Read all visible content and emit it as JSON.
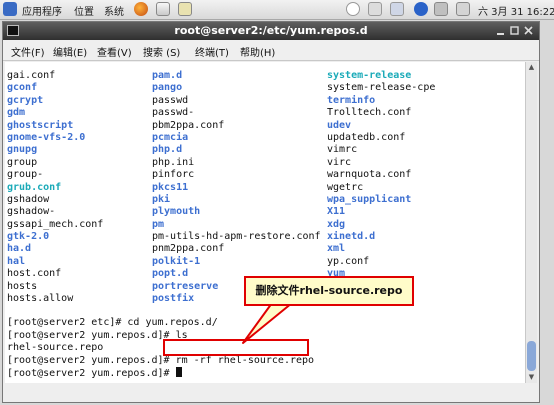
{
  "panel": {
    "menus": [
      "应用程序",
      "位置",
      "系统"
    ],
    "clock": "六 3月 31 16:22"
  },
  "window": {
    "title": "root@server2:/etc/yum.repos.d",
    "menu": [
      "文件(F)",
      "编辑(E)",
      "查看(V)",
      "搜索 (S)",
      "终端(T)",
      "帮助(H)"
    ]
  },
  "listing": {
    "col1": [
      {
        "text": "gai.conf",
        "type": "plain"
      },
      {
        "text": "gconf",
        "type": "dir"
      },
      {
        "text": "gcrypt",
        "type": "dir"
      },
      {
        "text": "gdm",
        "type": "dir"
      },
      {
        "text": "ghostscript",
        "type": "dir"
      },
      {
        "text": "gnome-vfs-2.0",
        "type": "dir"
      },
      {
        "text": "gnupg",
        "type": "dir"
      },
      {
        "text": "group",
        "type": "plain"
      },
      {
        "text": "group-",
        "type": "plain"
      },
      {
        "text": "grub.conf",
        "type": "link"
      },
      {
        "text": "gshadow",
        "type": "plain"
      },
      {
        "text": "gshadow-",
        "type": "plain"
      },
      {
        "text": "gssapi_mech.conf",
        "type": "plain"
      },
      {
        "text": "gtk-2.0",
        "type": "dir"
      },
      {
        "text": "ha.d",
        "type": "dir"
      },
      {
        "text": "hal",
        "type": "dir"
      },
      {
        "text": "host.conf",
        "type": "plain"
      },
      {
        "text": "hosts",
        "type": "plain"
      },
      {
        "text": "hosts.allow",
        "type": "plain"
      }
    ],
    "col2": [
      {
        "text": "pam.d",
        "type": "dir"
      },
      {
        "text": "pango",
        "type": "dir"
      },
      {
        "text": "passwd",
        "type": "plain"
      },
      {
        "text": "passwd-",
        "type": "plain"
      },
      {
        "text": "pbm2ppa.conf",
        "type": "plain"
      },
      {
        "text": "pcmcia",
        "type": "dir"
      },
      {
        "text": "php.d",
        "type": "dir"
      },
      {
        "text": "php.ini",
        "type": "plain"
      },
      {
        "text": "pinforc",
        "type": "plain"
      },
      {
        "text": "pkcs11",
        "type": "dir"
      },
      {
        "text": "pki",
        "type": "dir"
      },
      {
        "text": "plymouth",
        "type": "dir"
      },
      {
        "text": "pm",
        "type": "dir"
      },
      {
        "text": "pm-utils-hd-apm-restore.conf",
        "type": "plain"
      },
      {
        "text": "pnm2ppa.conf",
        "type": "plain"
      },
      {
        "text": "polkit-1",
        "type": "dir"
      },
      {
        "text": "popt.d",
        "type": "dir"
      },
      {
        "text": "portreserve",
        "type": "dir"
      },
      {
        "text": "postfix",
        "type": "dir"
      }
    ],
    "col3": [
      {
        "text": "system-release",
        "type": "link"
      },
      {
        "text": "system-release-cpe",
        "type": "plain"
      },
      {
        "text": "terminfo",
        "type": "dir"
      },
      {
        "text": "Trolltech.conf",
        "type": "plain"
      },
      {
        "text": "udev",
        "type": "dir"
      },
      {
        "text": "updatedb.conf",
        "type": "plain"
      },
      {
        "text": "vimrc",
        "type": "plain"
      },
      {
        "text": "virc",
        "type": "plain"
      },
      {
        "text": "warnquota.conf",
        "type": "plain"
      },
      {
        "text": "wgetrc",
        "type": "plain"
      },
      {
        "text": "wpa_supplicant",
        "type": "dir"
      },
      {
        "text": "X11",
        "type": "dir"
      },
      {
        "text": "xdg",
        "type": "dir"
      },
      {
        "text": "xinetd.d",
        "type": "dir"
      },
      {
        "text": "xml",
        "type": "dir"
      },
      {
        "text": "yp.conf",
        "type": "plain"
      },
      {
        "text": "yum",
        "type": "dir"
      }
    ]
  },
  "commands": {
    "line1": "[root@server2 etc]# cd yum.repos.d/",
    "line2": "[root@server2 yum.repos.d]# ls",
    "line3": "rhel-source.repo",
    "line4_prompt": "[root@server2 yum.repos.d]# ",
    "line4_cmd": "rm -rf rhel-source.repo",
    "line5_prompt": "[root@server2 yum.repos.d]# "
  },
  "annotation": {
    "text": "删除文件rhel-source.repo",
    "border_color": "#e00000",
    "fill_color": "#fffcc9"
  }
}
